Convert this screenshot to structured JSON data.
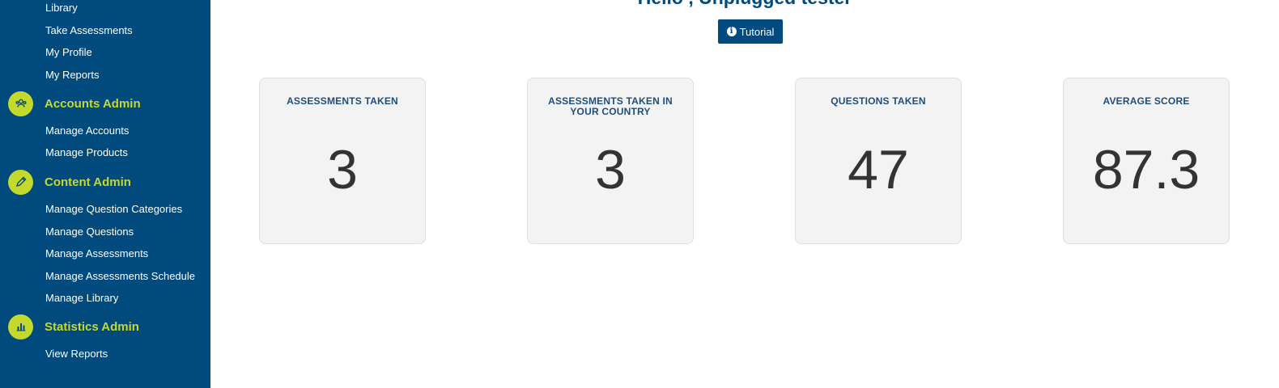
{
  "sidebar": {
    "top_links": [
      "Library",
      "Take Assessments",
      "My Profile",
      "My Reports"
    ],
    "sections": [
      {
        "label": "Accounts Admin",
        "icon": "users-icon",
        "links": [
          "Manage Accounts",
          "Manage Products"
        ]
      },
      {
        "label": "Content Admin",
        "icon": "pencil-icon",
        "links": [
          "Manage Question Categories",
          "Manage Questions",
          "Manage Assessments",
          "Manage Assessments Schedule",
          "Manage Library"
        ]
      },
      {
        "label": "Statistics Admin",
        "icon": "bar-chart-icon",
        "links": [
          "View Reports"
        ]
      }
    ]
  },
  "main": {
    "greeting": "Hello , Unplugged tester",
    "tutorial_label": "Tutorial",
    "stats": [
      {
        "title": "ASSESSMENTS TAKEN",
        "value": "3"
      },
      {
        "title": "ASSESSMENTS TAKEN IN YOUR COUNTRY",
        "value": "3"
      },
      {
        "title": "QUESTIONS TAKEN",
        "value": "47"
      },
      {
        "title": "AVERAGE SCORE",
        "value": "87.3"
      }
    ]
  },
  "colors": {
    "sidebar_bg": "#004a7d",
    "accent": "#c5d92d",
    "card_bg": "#f3f3f3",
    "heading": "#004a7d"
  }
}
